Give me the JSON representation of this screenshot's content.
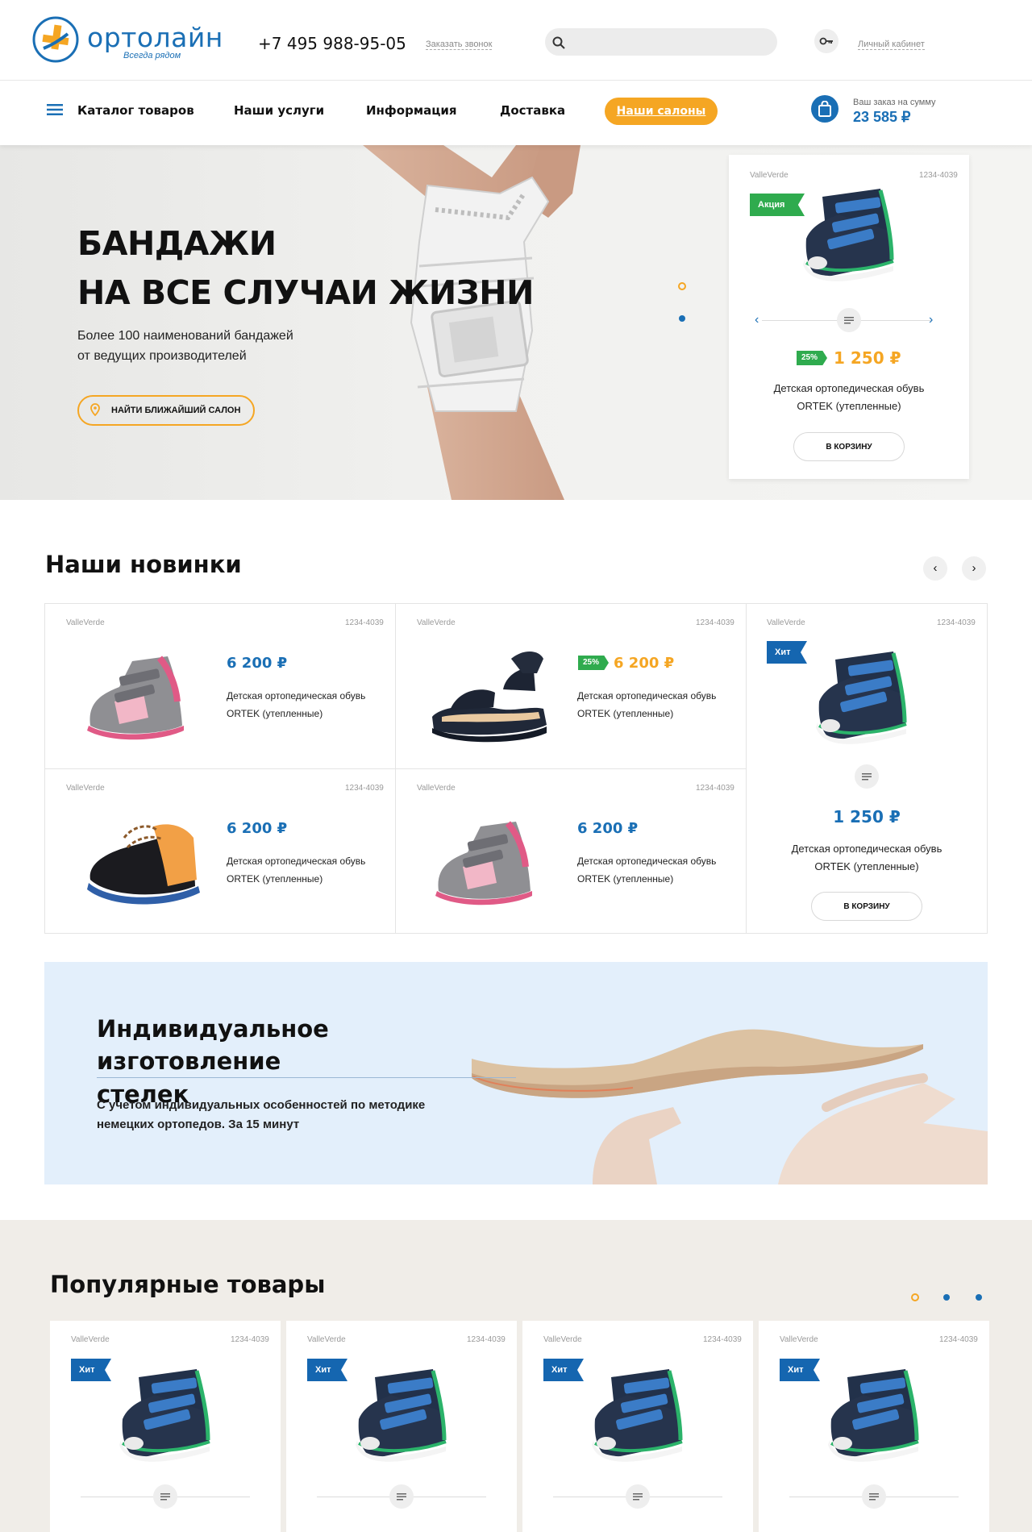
{
  "header": {
    "logo_text": "ортолайн",
    "logo_tagline": "Всегда рядом",
    "phone": "+7 495 988-95-05",
    "callback_link": "Заказать звонок",
    "search_placeholder": "",
    "account_link": "Личный кабинет"
  },
  "nav": {
    "catalog": "Каталог товаров",
    "services": "Наши услуги",
    "info": "Информация",
    "delivery": "Доставка",
    "salons": "Наши салоны",
    "cart_label": "Ваш заказ на сумму",
    "cart_sum": "23 585 ₽"
  },
  "hero": {
    "title_line1": "БАНДАЖИ",
    "title_line2": "НА ВСЕ СЛУЧАИ ЖИЗНИ",
    "subtitle_line1": "Более 100 наименований бандажей",
    "subtitle_line2": "от ведущих производителей",
    "button": "НАЙТИ БЛИЖАЙШИЙ САЛОН",
    "card": {
      "brand": "ValleVerde",
      "sku": "1234-4039",
      "badge": "Акция",
      "discount": "25%",
      "price": "1 250 ₽",
      "name_line1": "Детская ортопедическая обувь",
      "name_line2": "ORTEK (утепленные)",
      "cart_button": "В КОРЗИНУ"
    }
  },
  "new_items": {
    "title": "Наши новинки",
    "products": [
      {
        "brand": "ValleVerde",
        "sku": "1234-4039",
        "price": "6 200 ₽",
        "name_line1": "Детская ортопедическая обувь",
        "name_line2": "ORTEK (утепленные)"
      },
      {
        "brand": "ValleVerde",
        "sku": "1234-4039",
        "discount": "25%",
        "price": "6 200 ₽",
        "name_line1": "Детская ортопедическая обувь",
        "name_line2": "ORTEK (утепленные)"
      },
      {
        "brand": "ValleVerde",
        "sku": "1234-4039",
        "badge": "Хит",
        "price": "1 250 ₽",
        "name_line1": "Детская ортопедическая обувь",
        "name_line2": "ORTEK (утепленные)",
        "cart_button": "В КОРЗИНУ"
      },
      {
        "brand": "ValleVerde",
        "sku": "1234-4039",
        "price": "6 200 ₽",
        "name_line1": "Детская ортопедическая обувь",
        "name_line2": "ORTEK (утепленные)"
      },
      {
        "brand": "ValleVerde",
        "sku": "1234-4039",
        "price": "6 200 ₽",
        "name_line1": "Детская ортопедическая обувь",
        "name_line2": "ORTEK (утепленные)"
      }
    ]
  },
  "banner": {
    "title_line1": "Индивидуальное изготовление",
    "title_line2": "стелек",
    "subtitle_line1": "С учетом индивидуальных особенностей по методике",
    "subtitle_line2": "немецких ортопедов. За 15 минут"
  },
  "popular": {
    "title": "Популярные товары",
    "products": [
      {
        "brand": "ValleVerde",
        "sku": "1234-4039",
        "badge": "Хит"
      },
      {
        "brand": "ValleVerde",
        "sku": "1234-4039",
        "badge": "Хит"
      },
      {
        "brand": "ValleVerde",
        "sku": "1234-4039",
        "badge": "Хит"
      },
      {
        "brand": "ValleVerde",
        "sku": "1234-4039",
        "badge": "Хит"
      }
    ]
  },
  "colors": {
    "brand_blue": "#1a6fb5",
    "accent_orange": "#f5a623",
    "sale_green": "#2fab4e",
    "hit_blue": "#1566b0"
  },
  "icons": [
    "logo-icon",
    "search-icon",
    "key-icon",
    "menu-icon",
    "shopping-bag-icon",
    "location-pin-icon",
    "chevron-left-icon",
    "chevron-right-icon",
    "list-icon"
  ]
}
